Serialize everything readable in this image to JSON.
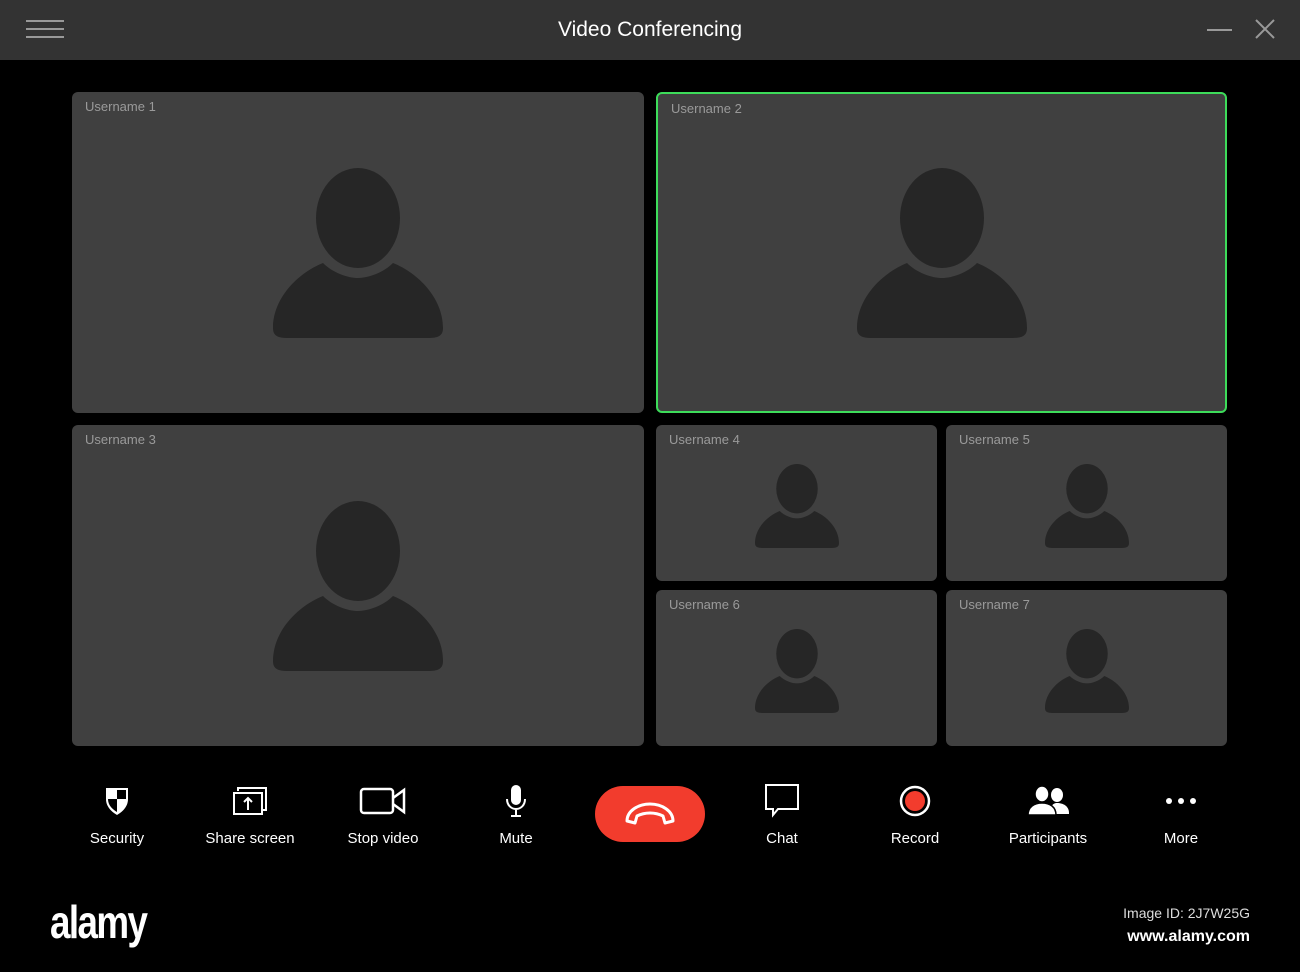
{
  "window": {
    "title": "Video Conferencing"
  },
  "tiles": [
    {
      "username": "Username 1",
      "active": false
    },
    {
      "username": "Username 2",
      "active": true
    },
    {
      "username": "Username 3",
      "active": false
    },
    {
      "username": "Username 4",
      "active": false
    },
    {
      "username": "Username 5",
      "active": false
    },
    {
      "username": "Username 6",
      "active": false
    },
    {
      "username": "Username 7",
      "active": false
    }
  ],
  "toolbar": {
    "security": "Security",
    "share": "Share screen",
    "video": "Stop video",
    "mute": "Mute",
    "chat": "Chat",
    "record": "Record",
    "participants": "Participants",
    "more": "More"
  },
  "colors": {
    "active_border": "#3ddc5a",
    "hangup": "#f23c2d",
    "record": "#f23c2d"
  },
  "watermark": {
    "logo": "alamy",
    "image_id": "Image ID: 2J7W25G",
    "site": "www.alamy.com"
  }
}
